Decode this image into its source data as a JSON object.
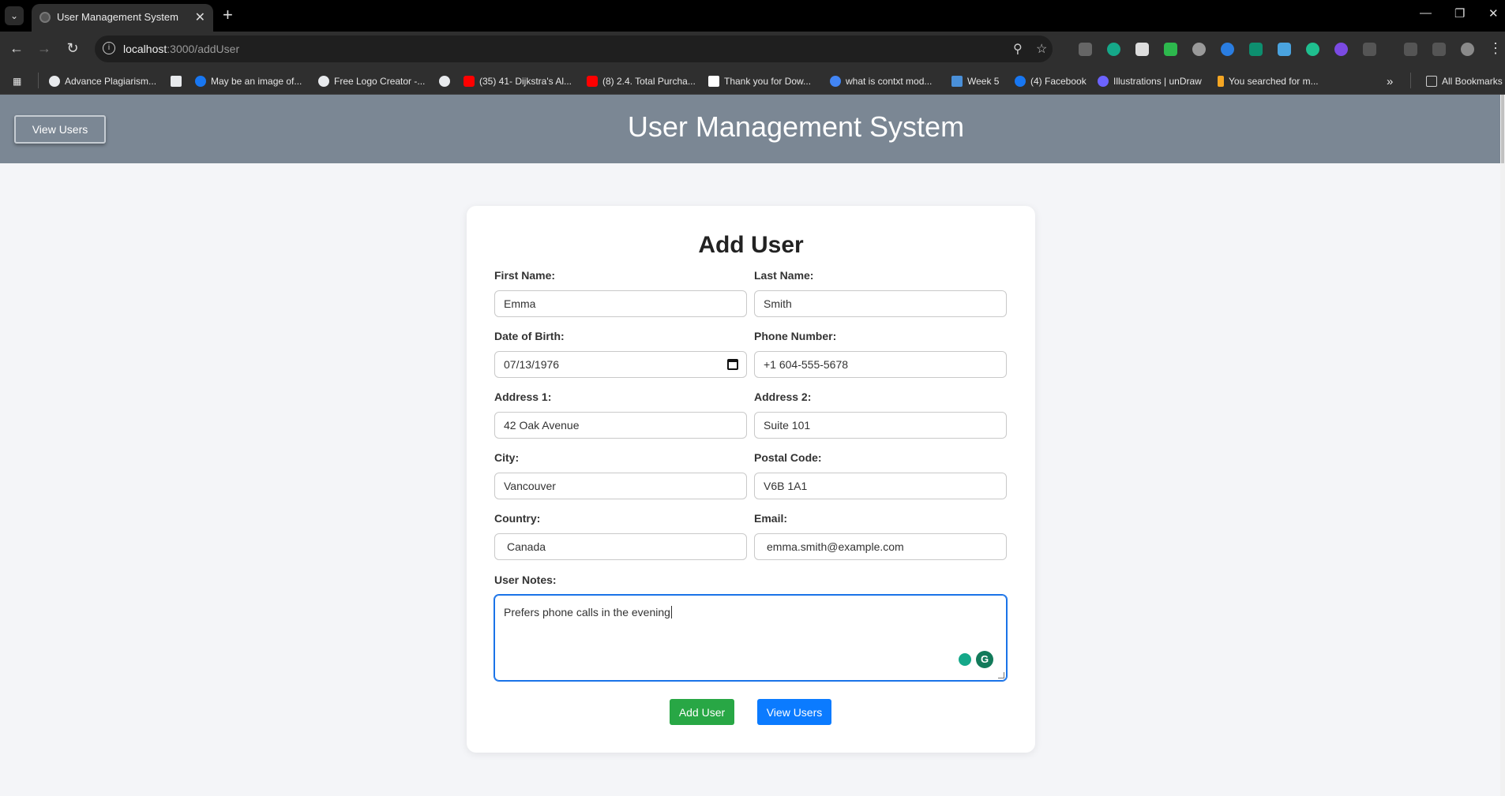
{
  "browser": {
    "tab_title": "User Management System",
    "url_host": "localhost",
    "url_path": ":3000/addUser",
    "bookmarks": [
      {
        "label": "Advance Plagiarism...",
        "color": "#e8eaed"
      },
      {
        "label": "",
        "color": "#e8eaed"
      },
      {
        "label": "May be an image of...",
        "color": "#1877f2"
      },
      {
        "label": "Free Logo Creator -...",
        "color": "#e8eaed"
      },
      {
        "label": "",
        "color": "#e8eaed"
      },
      {
        "label": "(35) 41- Dijkstra's Al...",
        "color": "#ff0000"
      },
      {
        "label": "(8) 2.4. Total Purcha...",
        "color": "#ff0000"
      },
      {
        "label": "Thank you for Dow...",
        "color": "#ffffff"
      },
      {
        "label": "what is contxt mod...",
        "color": "#4285f4"
      },
      {
        "label": "Week 5",
        "color": "#4a90d9"
      },
      {
        "label": "(4) Facebook",
        "color": "#1877f2"
      },
      {
        "label": "Illustrations | unDraw",
        "color": "#6c63ff"
      },
      {
        "label": "You searched for m...",
        "color": "#f5a623"
      }
    ],
    "all_bookmarks": "All Bookmarks"
  },
  "header": {
    "view_users_button": "View Users",
    "title": "User Management System"
  },
  "form": {
    "title": "Add User",
    "first_name": {
      "label": "First Name:",
      "value": "Emma"
    },
    "last_name": {
      "label": "Last Name:",
      "value": "Smith"
    },
    "dob": {
      "label": "Date of Birth:",
      "value": "07/13/1976"
    },
    "phone": {
      "label": "Phone Number:",
      "value": "+1 604-555-5678"
    },
    "address1": {
      "label": "Address 1:",
      "value": "42 Oak Avenue"
    },
    "address2": {
      "label": "Address 2:",
      "value": "Suite 101"
    },
    "city": {
      "label": "City:",
      "value": "Vancouver"
    },
    "postal": {
      "label": "Postal Code:",
      "value": "V6B 1A1"
    },
    "country": {
      "label": "Country:",
      "value": "Canada"
    },
    "email": {
      "label": "Email:",
      "value": "emma.smith@example.com"
    },
    "notes": {
      "label": "User Notes:",
      "value": "Prefers phone calls in the evening"
    },
    "add_button": "Add User",
    "view_button": "View Users"
  },
  "colors": {
    "header_bg": "#7b8794",
    "add_button": "#28a745",
    "view_button": "#0b7bff"
  }
}
